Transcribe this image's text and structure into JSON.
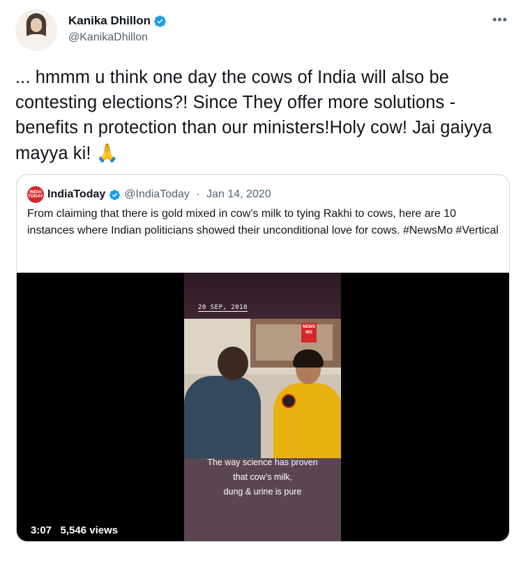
{
  "author": {
    "name": "Kanika Dhillon",
    "handle": "@KanikaDhillon",
    "verified": true
  },
  "menu_icon": "more-icon",
  "tweet": {
    "text": "... hmmm u think  one day the cows of India will also be contesting elections?! Since They offer more solutions - benefits n protection than our ministers!Holy cow! Jai gaiyya mayya ki!",
    "emoji": "🙏"
  },
  "quoted_tweet": {
    "logo_text": "INDIA TODAY",
    "name": "IndiaToday",
    "handle": "@IndiaToday",
    "separator": " · ",
    "date": "Jan 14, 2020",
    "text": "From claiming that there is gold mixed in cow’s milk to tying Rakhi to cows, here are 10 instances where Indian politicians showed their unconditional love for cows. #NewsMo #Vertical",
    "video": {
      "date_overlay": "20 SEP, 2018",
      "badge": "NEWS MO",
      "caption_lines": [
        "The way science has proven",
        "that cow’s milk,",
        "dung & urine is pure"
      ],
      "duration": "3:07",
      "views": "5,546 views"
    }
  },
  "colors": {
    "verified_blue": "#1d9bf0",
    "secondary_text": "#536471",
    "border": "#cfd9de"
  }
}
